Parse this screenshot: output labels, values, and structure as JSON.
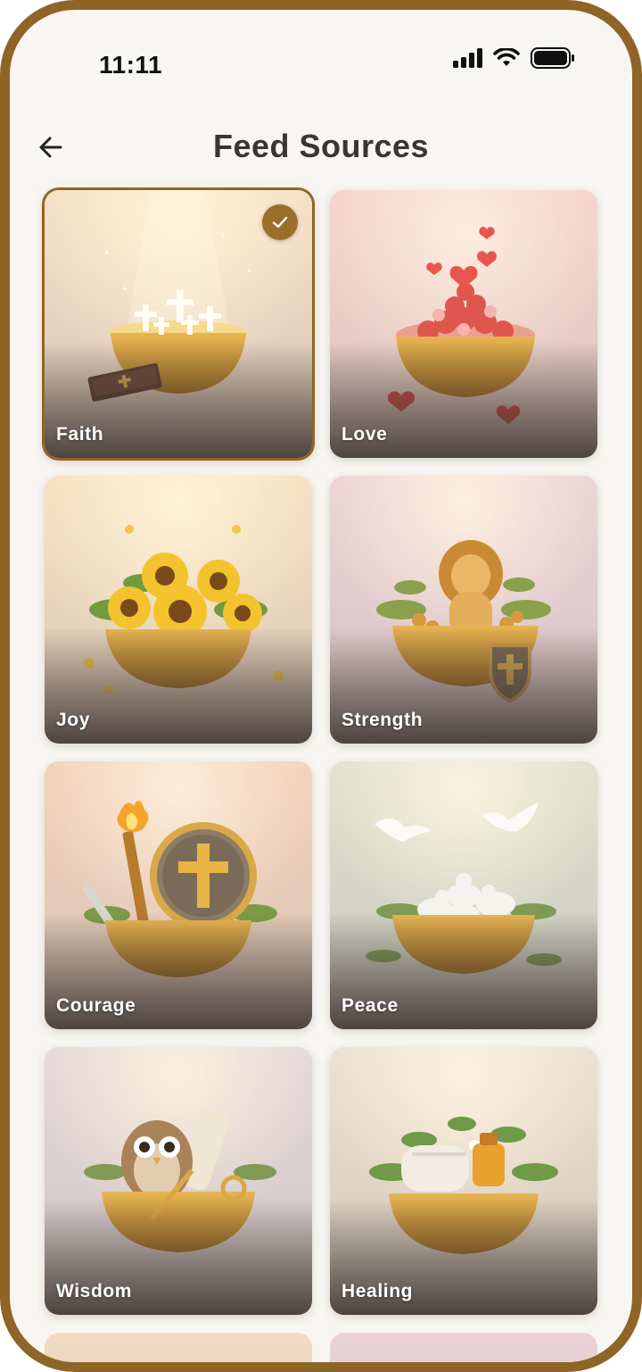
{
  "status_bar": {
    "time": "11:11"
  },
  "header": {
    "title": "Feed Sources"
  },
  "cards": [
    {
      "label": "Faith",
      "selected": true
    },
    {
      "label": "Love",
      "selected": false
    },
    {
      "label": "Joy",
      "selected": false
    },
    {
      "label": "Strength",
      "selected": false
    },
    {
      "label": "Courage",
      "selected": false
    },
    {
      "label": "Peace",
      "selected": false
    },
    {
      "label": "Wisdom",
      "selected": false
    },
    {
      "label": "Healing",
      "selected": false
    }
  ],
  "colors": {
    "accent": "#8f6527",
    "check": "#9a6f2a",
    "background": "#f8f6f2",
    "title": "#3a3530"
  }
}
